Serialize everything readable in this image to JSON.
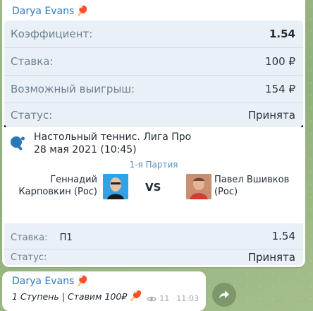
{
  "message1": {
    "sender": "Darya Evans",
    "sender_emoji": "🏓",
    "ticket": {
      "coefficient_label": "Коэффициент:",
      "coefficient_value": "1.54",
      "stake_label": "Ставка:",
      "stake_value": "100 ₽",
      "possible_win_label": "Возможный выигрыш:",
      "possible_win_value": "154 ₽",
      "status_label": "Статус:",
      "status_value": "Принята"
    },
    "event": {
      "icon": "table-tennis-icon",
      "title": "Настольный теннис. Лига Про",
      "date": "28 мая 2021 (10:45)",
      "round": "1-я Партия",
      "player1_line1": "Геннадий",
      "player1_line2": "Карповкин (Рос)",
      "vs": "VS",
      "player2_line1": "Павел Вшивков",
      "player2_line2": "(Рос)",
      "bet_label": "Ставка:",
      "bet_outcome": "П1",
      "bet_coef": "1.54",
      "status_label": "Статус:",
      "status_value": "Принята"
    }
  },
  "message2": {
    "sender": "Darya Evans",
    "sender_emoji": "🏓",
    "text": "1 Ступень | Ставим 100₽",
    "text_emoji": "🏓",
    "views": "11",
    "time": "11:03"
  },
  "colors": {
    "sender": "#2f7bbf",
    "ticket_bg": "#e9f0f6",
    "round_text": "#5d8fbf"
  }
}
